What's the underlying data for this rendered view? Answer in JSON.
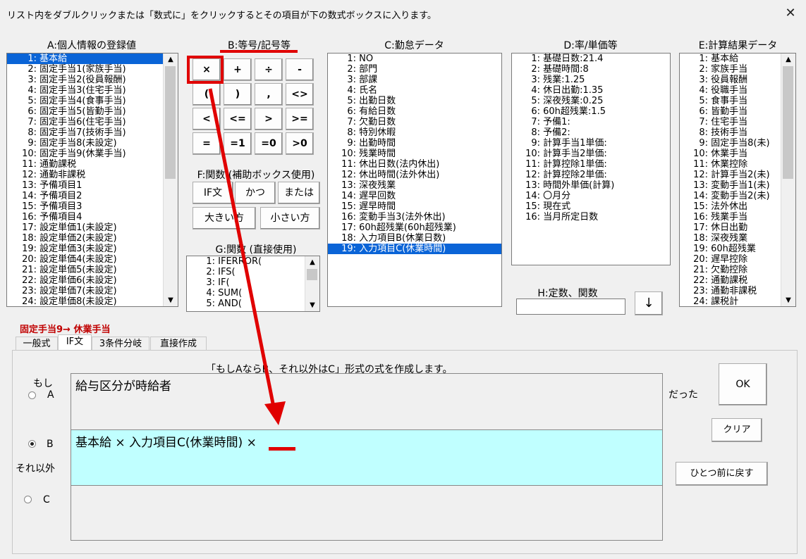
{
  "window": {
    "title": "リスト内をダブルクリックまたは「数式に」をクリックするとその項目が下の数式ボックスに入ります。",
    "close_icon": "close-icon"
  },
  "headers": {
    "a": "A:個人情報の登録値",
    "b": "B:等号/記号等",
    "c": "C:勤怠データ",
    "d": "D:率/単価等",
    "e": "E:計算結果データ",
    "f": "F:関数 (補助ボックス使用)",
    "g": "G:関数 (直接使用)",
    "h": "H:定数、関数"
  },
  "list_a": [
    "1: 基本給",
    "2: 固定手当1(家族手当)",
    "3: 固定手当2(役員報酬)",
    "4: 固定手当3(住宅手当)",
    "5: 固定手当4(食事手当)",
    "6: 固定手当5(皆勤手当)",
    "7: 固定手当6(住宅手当)",
    "8: 固定手当7(技術手当)",
    "9: 固定手当8(未設定)",
    "10: 固定手当9(休業手当)",
    "11: 通勤課税",
    "12: 通勤非課税",
    "13: 予備項目1",
    "14: 予備項目2",
    "15: 予備項目3",
    "16: 予備項目4",
    "17: 設定単価1(未設定)",
    "18: 設定単価2(未設定)",
    "19: 設定単価3(未設定)",
    "20: 設定単価4(未設定)",
    "21: 設定単価5(未設定)",
    "22: 設定単価6(未設定)",
    "23: 設定単価7(未設定)",
    "24: 設定単価8(未設定)"
  ],
  "list_c": [
    "1: NO",
    "2: 部門",
    "3: 部課",
    "4: 氏名",
    "5: 出勤日数",
    "6: 有給日数",
    "7: 欠勤日数",
    "8: 特別休暇",
    "9: 出勤時間",
    "10: 残業時間",
    "11: 休出日数(法内休出)",
    "12: 休出時間(法外休出)",
    "13: 深夜残業",
    "14: 遅早回数",
    "15: 遅早時間",
    "16: 変動手当3(法外休出)",
    "17: 60h超残業(60h超残業)",
    "18: 入力項目B(休業日数)",
    "19: 入力項目C(休業時間)"
  ],
  "list_d": [
    "1: 基礎日数:21.4",
    "2: 基礎時間:8",
    "3: 残業:1.25",
    "4: 休日出勤:1.35",
    "5: 深夜残業:0.25",
    "6: 60h超残業:1.5",
    "7: 予備1:",
    "8: 予備2:",
    "9: 計算手当1単価:",
    "10: 計算手当2単価:",
    "11: 計算控除1単価:",
    "12: 計算控除2単価:",
    "13: 時間外単価(計算)",
    "14: 〇月分",
    "15: 現在式",
    "16: 当月所定日数"
  ],
  "list_e": [
    "1: 基本給",
    "2: 家族手当",
    "3: 役員報酬",
    "4: 役職手当",
    "5: 食事手当",
    "6: 皆勤手当",
    "7: 住宅手当",
    "8: 技術手当",
    "9: 固定手当8(未)",
    "10: 休業手当",
    "11: 休業控除",
    "12: 計算手当2(未)",
    "13: 変動手当1(未)",
    "14: 変動手当2(未)",
    "15: 法外休出",
    "16: 残業手当",
    "17: 休日出勤",
    "18: 深夜残業",
    "19: 60h超残業",
    "20: 遅早控除",
    "21: 欠勤控除",
    "22: 通勤課税",
    "23: 通勤非課税",
    "24: 課税計"
  ],
  "list_g": [
    "1: IFERROR(",
    "2: IFS(",
    "3: IF(",
    "4: SUM(",
    "5: AND("
  ],
  "symbols": [
    "×",
    "+",
    "÷",
    "-",
    "(",
    ")",
    ",",
    "<>",
    "<",
    "<=",
    ">",
    ">=",
    "=",
    "=1",
    "=0",
    ">0"
  ],
  "func_buttons": {
    "if": "IF文",
    "and": "かつ",
    "or": "または",
    "max": "大きい方",
    "min": "小さい方"
  },
  "h_input": "",
  "arrow_down": "↓",
  "status_label": "固定手当9→ 休業手当",
  "tabs": [
    "一般式",
    "IF文",
    "3条件分岐",
    "直接作成"
  ],
  "form": {
    "description": "「もしAならB、それ以外はC」形式の式を作成します。",
    "if_label": "もし",
    "a": "A",
    "b": "B",
    "c": "C",
    "else_label": "それ以外",
    "then_label": "だった",
    "box_a": "給与区分が時給者",
    "box_b": "基本給 × 入力項目C(休業時間) ×",
    "box_c": ""
  },
  "actions": {
    "ok": "OK",
    "clear": "クリア",
    "undo": "ひとつ前に戻す"
  },
  "colors": {
    "accent": "#0a64d7",
    "highlight": "#e00000",
    "box_b_bg": "#c0ffff",
    "status": "#c00000"
  }
}
